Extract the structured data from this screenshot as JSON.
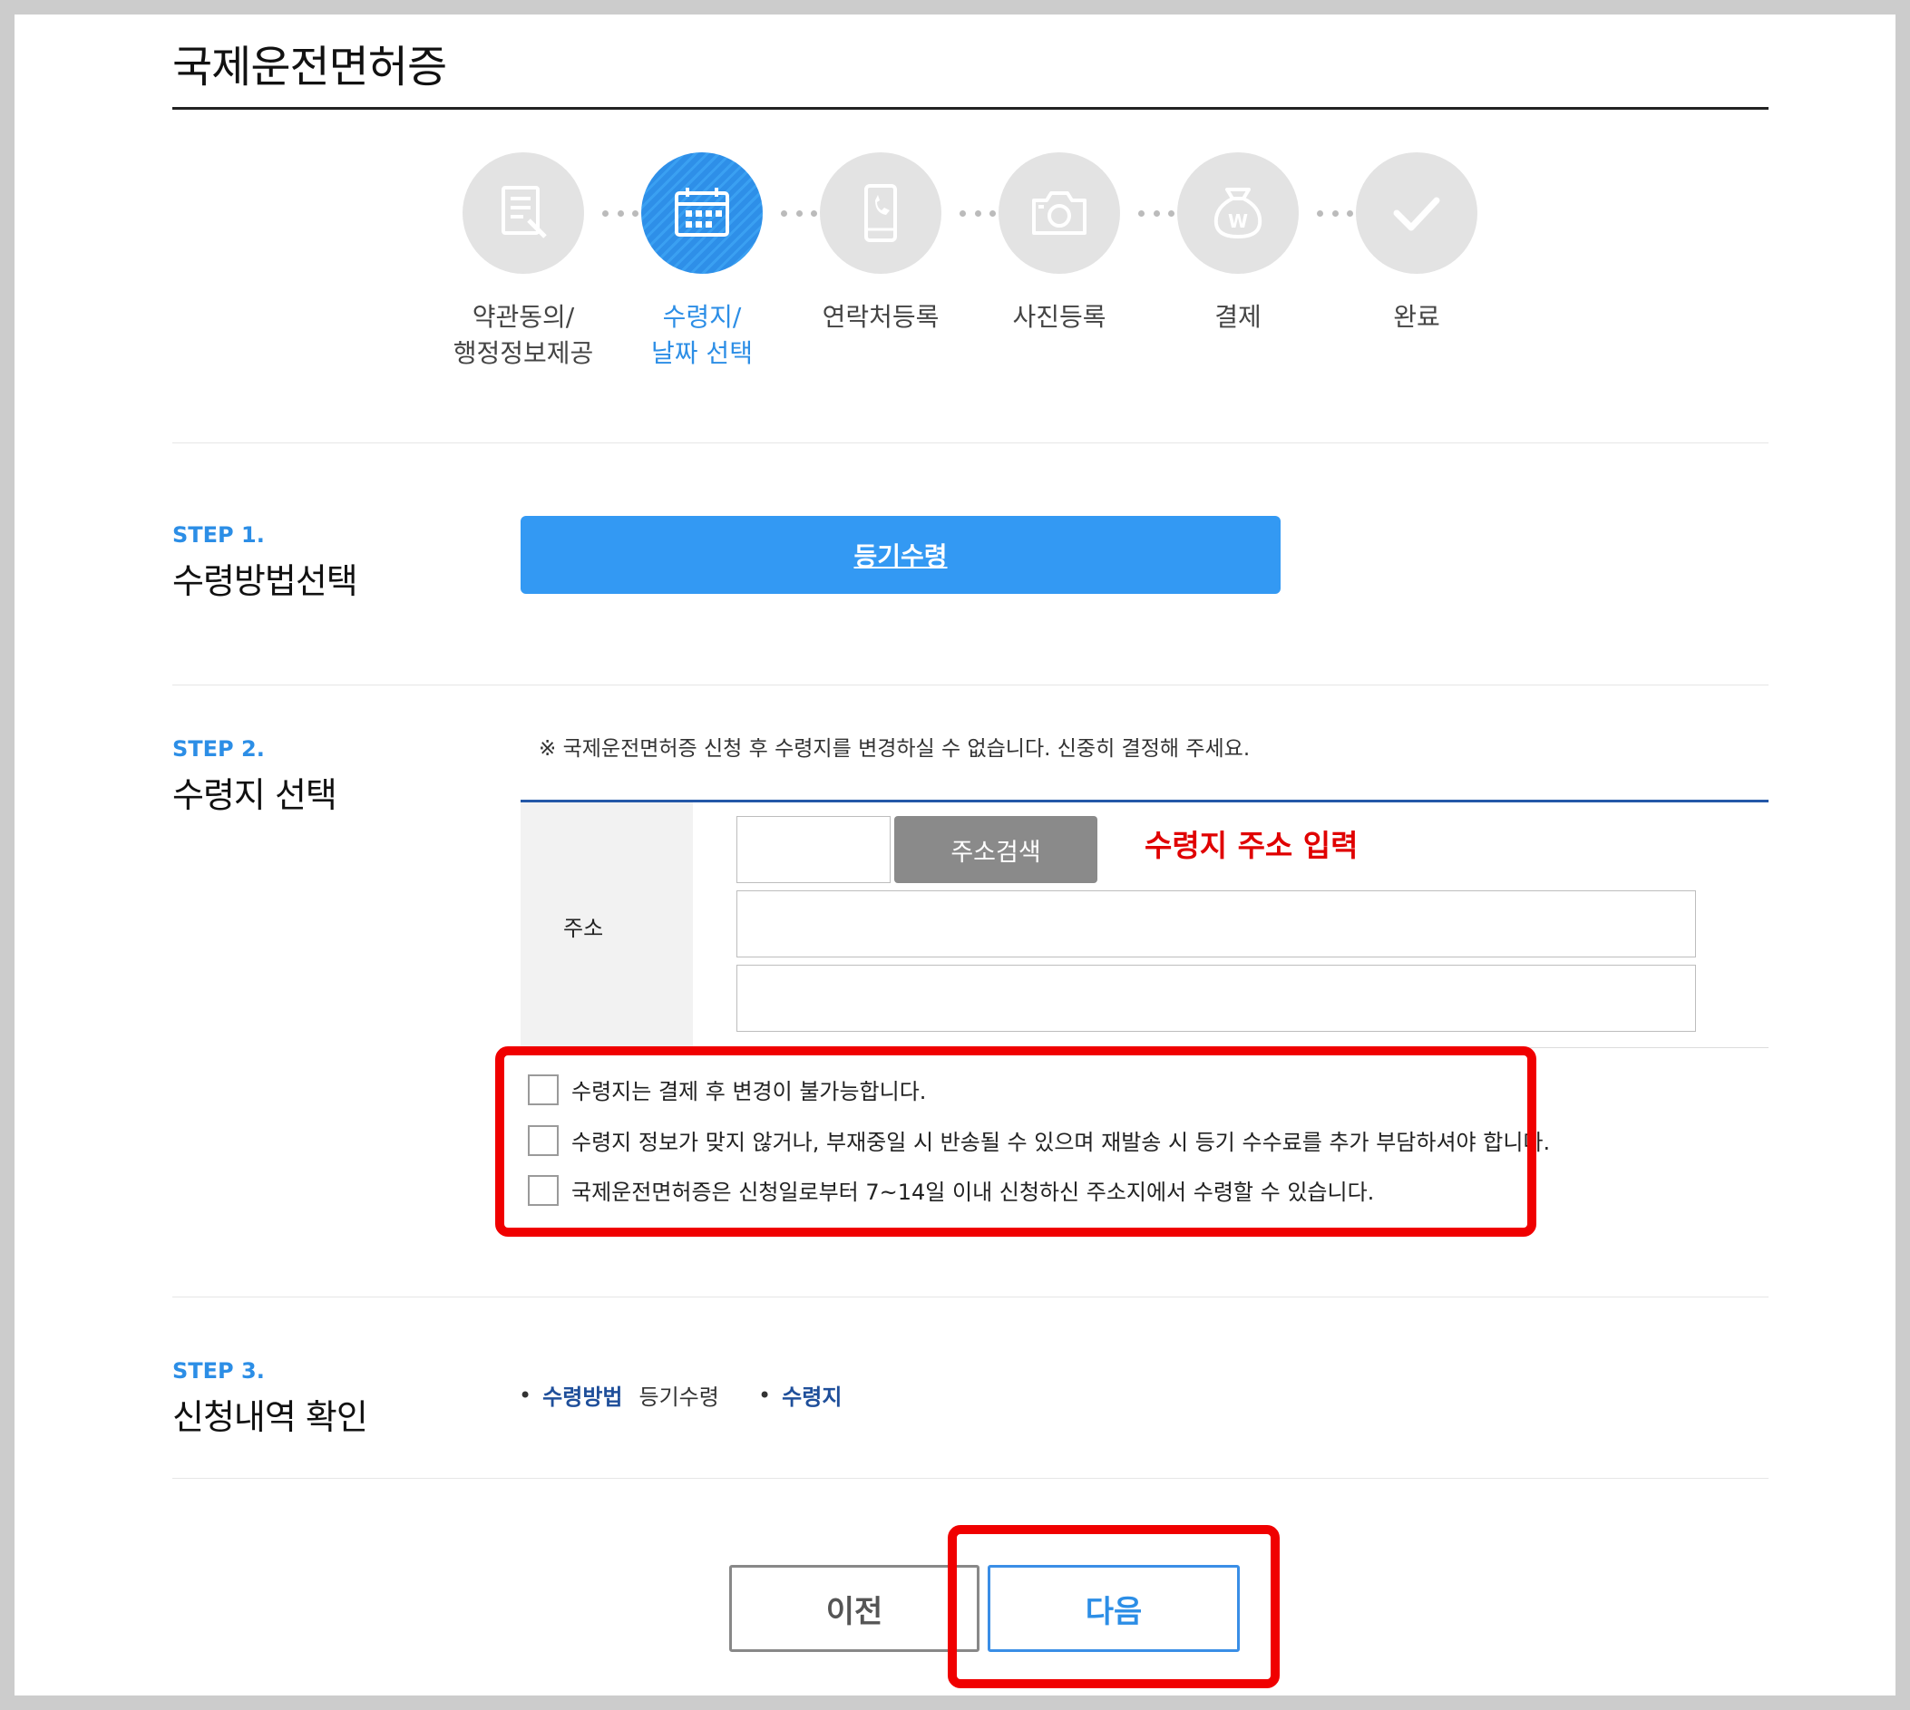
{
  "page": {
    "title": "국제운전면허증"
  },
  "steps": [
    {
      "label": "약관동의/\n행정정보제공",
      "icon": "document-pen-icon",
      "active": false
    },
    {
      "label": "수령지/\n날짜 선택",
      "icon": "calendar-icon",
      "active": true
    },
    {
      "label": "연락처등록",
      "icon": "phone-icon",
      "active": false
    },
    {
      "label": "사진등록",
      "icon": "camera-icon",
      "active": false
    },
    {
      "label": "결제",
      "icon": "money-bag-icon",
      "active": false
    },
    {
      "label": "완료",
      "icon": "check-icon",
      "active": false
    }
  ],
  "step1": {
    "number": "STEP 1.",
    "title": "수령방법선택",
    "method_button": "등기수령"
  },
  "step2": {
    "number": "STEP 2.",
    "title": "수령지 선택",
    "notice": "※ 국제운전면허증 신청 후 수령지를 변경하실 수 없습니다. 신중히 결정해 주세요.",
    "address_label": "주소",
    "postal_code_value": "",
    "address1_value": "",
    "address2_value": "",
    "search_button": "주소검색",
    "annotation": "수령지 주소 입력",
    "checks": [
      {
        "text": "수령지는 결제 후 변경이 불가능합니다.",
        "checked": false
      },
      {
        "text": "수령지 정보가 맞지 않거나, 부재중일 시 반송될 수 있으며 재발송 시 등기 수수료를 추가 부담하셔야 합니다.",
        "checked": false
      },
      {
        "text": "국제운전면허증은 신청일로부터 7~14일 이내 신청하신 주소지에서 수령할 수 있습니다.",
        "checked": false
      }
    ]
  },
  "step3": {
    "number": "STEP 3.",
    "title": "신청내역 확인",
    "bullet": "•",
    "method_key": "수령방법",
    "method_value": "등기수령",
    "place_key": "수령지",
    "place_value": ""
  },
  "nav": {
    "prev": "이전",
    "next": "다음"
  },
  "colors": {
    "accent_blue": "#2c8ee6",
    "button_blue": "#3399f3",
    "navy": "#1f4f9a",
    "annotation_red": "#f00000"
  }
}
